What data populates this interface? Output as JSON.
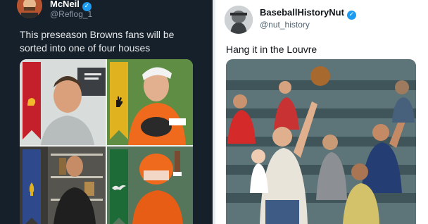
{
  "left_tweet": {
    "name": "McNeil",
    "handle": "@Reflog_1",
    "text": "This preseason Browns fans will be sorted into one of four houses",
    "verified": true,
    "house_colors": [
      "#c4202c",
      "#e0b21f",
      "#2f4a8c",
      "#1d6b36"
    ],
    "house_icons": [
      "lion-icon",
      "hand-icon",
      "rocket-icon",
      "bird-icon"
    ]
  },
  "right_tweet": {
    "name": "BaseballHistoryNut",
    "handle": "@nut_history",
    "text": "Hang it in the Louvre",
    "verified": true
  },
  "accent": "#1d9bf0",
  "verified_glyph": "✓"
}
